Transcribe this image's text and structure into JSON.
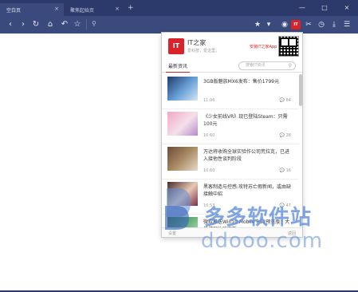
{
  "browser": {
    "tabs": [
      {
        "label": "空白页",
        "active": true
      },
      {
        "label": "聚焦起始页",
        "active": false
      }
    ],
    "new_tab": "+",
    "window_controls": [
      "—",
      "□",
      "×"
    ],
    "ext_badge": "IT"
  },
  "popup": {
    "brand": "IT之家",
    "logo_text": "IT",
    "slogan": "爱科技，爱这里。",
    "install_app": "安装IT之家App",
    "tab_label": "最新资讯",
    "search_placeholder": "搜索IT资讯",
    "items": [
      {
        "title": "3GB版魅族MX6发布：售价1799元",
        "time": "11:06",
        "comments": "84"
      },
      {
        "title": "《少女前线VR》现已登陆Steam：只需100元",
        "time": "10:60",
        "comments": "28"
      },
      {
        "title": "万达将收购全球实验作公司荒拉克，已进入接他性谈判阶段",
        "time": "10:60",
        "comments": "16"
      },
      {
        "title": "黑客制造与控感:攻特苏亡假新闻，或由缺接触中招",
        "time": "10:53",
        "comments": "47"
      },
      {
        "title": "微软推送Win10 Mobile RS2预览版：大量扩展体验更新",
        "time": "",
        "comments": ""
      }
    ],
    "footer_left": "设置",
    "footer_right": "返回"
  },
  "watermark": {
    "cn": "多多软件站",
    "en": "ddooo.com"
  },
  "colors": {
    "titlebar": "#2c3a6b",
    "toolbar": "#3a4a7c",
    "accent": "#d9222a"
  }
}
